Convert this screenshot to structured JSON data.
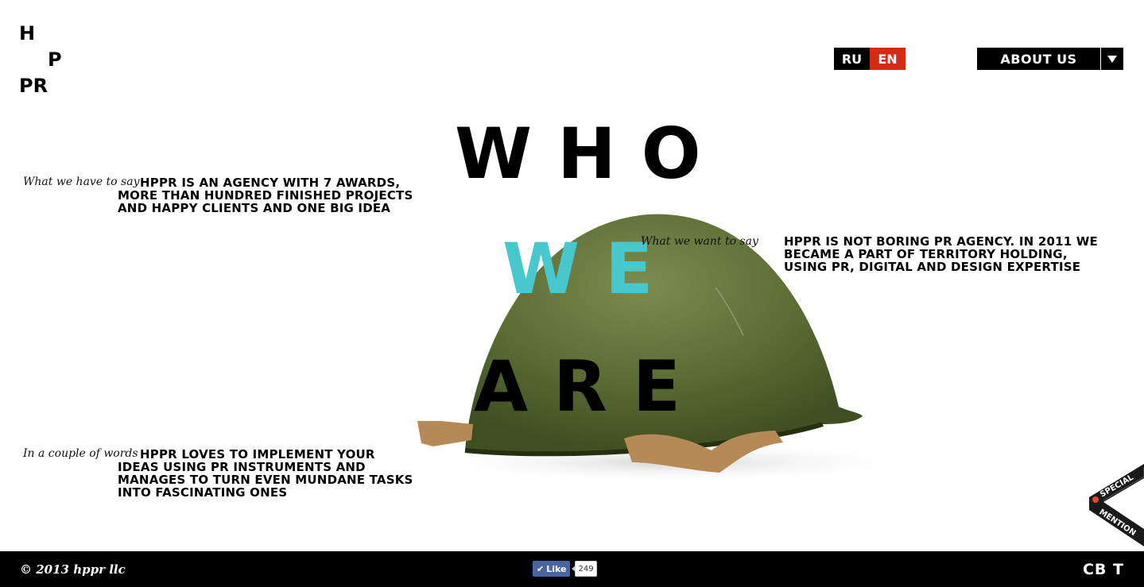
{
  "logo": {
    "line1": "H",
    "line2": "P",
    "line3": "PR"
  },
  "lang": {
    "ru": "RU",
    "en": "EN"
  },
  "nav": {
    "about_label": "ABOUT US"
  },
  "headline": {
    "who": "WHO",
    "we": "WE",
    "are": "ARE"
  },
  "blocks": [
    {
      "caption": "What we have to say",
      "text": "HPPR IS AN AGENCY WITH 7 AWARDS, MORE THAN HUNDRED FINISHED PROJECTS AND HAPPY CLIENTS AND ONE BIG IDEA"
    },
    {
      "caption": "What we want to say",
      "text": "HPPR IS NOT BORING PR AGENCY. IN 2011 WE BECAME A PART OF TERRITORY HOLDING, USING PR, DIGITAL AND DESIGN EXPERTISE"
    },
    {
      "caption": "In a couple of words",
      "text": "HPPR LOVES TO IMPLEMENT YOUR IDEAS USING PR INSTRUMENTS AND MANAGES TO TURN EVEN MUNDANE TASKS INTO FASCINATING ONES"
    }
  ],
  "ribbon": {
    "line1": "SPECIAL",
    "line2": "MENTION"
  },
  "footer": {
    "copyright": "© 2013 hppr llc",
    "like_label": "Like",
    "like_count": "249",
    "brand": "CB T"
  },
  "colors": {
    "accent_cyan": "#48c8cc",
    "lang_active": "#d52b14",
    "helmet_green": "#5b6e34"
  }
}
